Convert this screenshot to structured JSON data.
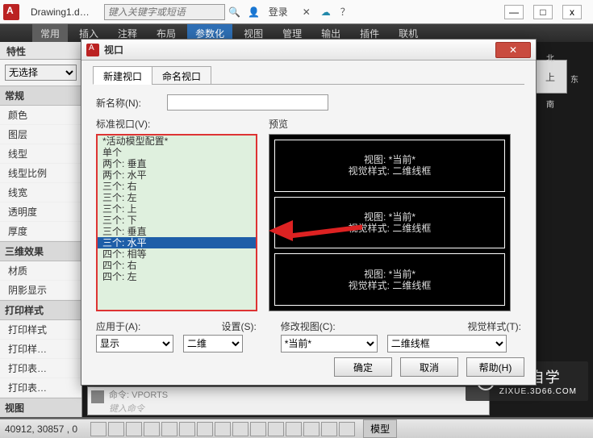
{
  "titlebar": {
    "doc_title": "Drawing1.d…",
    "search_placeholder": "键入关键字或短语",
    "signin": "登录"
  },
  "winbtns": {
    "min": "—",
    "max": "□",
    "close": "x"
  },
  "ribbon": {
    "tabs": [
      "常用",
      "插入",
      "注释",
      "布局",
      "参数化",
      "视图",
      "管理",
      "输出",
      "插件",
      "联机"
    ]
  },
  "properties": {
    "panel_title": "特性",
    "selection": "无选择",
    "sections": [
      {
        "title": "常规",
        "rows": [
          "颜色",
          "图层",
          "线型",
          "线型比例",
          "线宽",
          "透明度",
          "厚度"
        ]
      },
      {
        "title": "三维效果",
        "rows": [
          "材质",
          "阴影显示"
        ]
      },
      {
        "title": "打印样式",
        "rows": [
          "打印样式",
          "打印样…",
          "打印表…",
          "打印表…"
        ]
      },
      {
        "title": "视图",
        "rows": []
      }
    ]
  },
  "viewcube": {
    "top": "上",
    "n": "北",
    "e": "东",
    "s": "南"
  },
  "command": {
    "prompt": "命令: VPORTS",
    "hint": "键入命令"
  },
  "statusbar": {
    "coords": "40912, 30857 , 0",
    "model": "模型"
  },
  "watermark": {
    "brand": "溜溜自学",
    "url": "ZIXUE.3D66.COM"
  },
  "dialog": {
    "title": "视口",
    "tabs": {
      "new": "新建视口",
      "named": "命名视口"
    },
    "new_name_label": "新名称(N):",
    "new_name_value": "",
    "std_label": "标准视口(V):",
    "items": [
      "*活动模型配置*",
      "单个",
      "两个: 垂直",
      "两个: 水平",
      "三个: 右",
      "三个: 左",
      "三个: 上",
      "三个: 下",
      "三个: 垂直",
      "三个: 水平",
      "四个: 相等",
      "四个: 右",
      "四个: 左"
    ],
    "selected_index": 9,
    "preview_label": "预览",
    "preview_pane": {
      "l1": "视图: *当前*",
      "l2": "视觉样式: 二维线框"
    },
    "apply_label": "应用于(A):",
    "apply_value": "显示",
    "setup_label": "设置(S):",
    "setup_value": "二维",
    "changeview_label": "修改视图(C):",
    "changeview_value": "*当前*",
    "visualstyle_label": "视觉样式(T):",
    "visualstyle_value": "二维线框",
    "buttons": {
      "ok": "确定",
      "cancel": "取消",
      "help": "帮助(H)"
    }
  }
}
